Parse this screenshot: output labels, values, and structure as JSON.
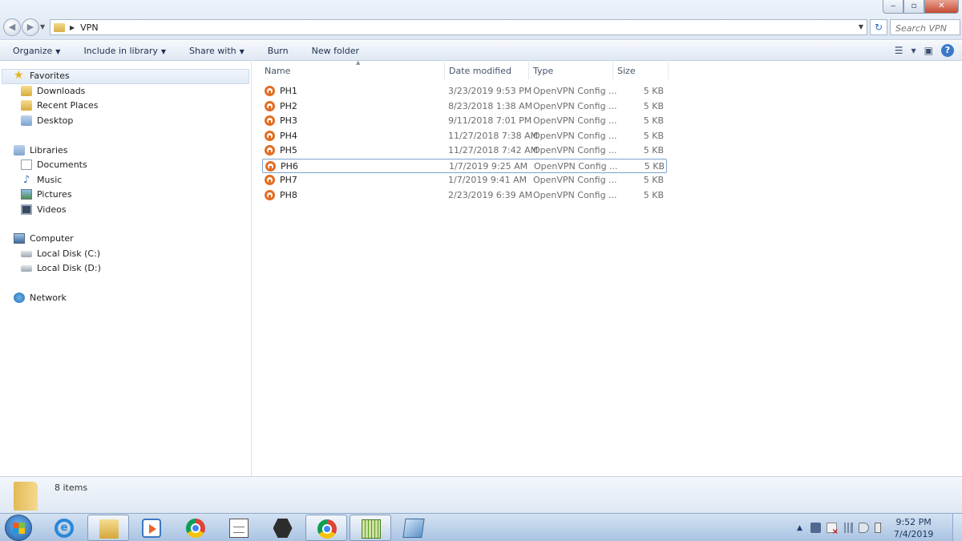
{
  "address_bar": {
    "path": [
      "VPN"
    ],
    "search_placeholder": "Search VPN"
  },
  "window_controls": {
    "minimize": "‒",
    "maximize": "▫",
    "close": "✕"
  },
  "toolbar": {
    "items": [
      {
        "label": "Organize",
        "dropdown": true
      },
      {
        "label": "Include in library",
        "dropdown": true
      },
      {
        "label": "Share with",
        "dropdown": true
      },
      {
        "label": "Burn",
        "dropdown": false
      },
      {
        "label": "New folder",
        "dropdown": false
      }
    ],
    "help_label": "?"
  },
  "nav_pane": {
    "favorites": {
      "label": "Favorites",
      "items": [
        "Downloads",
        "Recent Places",
        "Desktop"
      ]
    },
    "libraries": {
      "label": "Libraries",
      "items": [
        "Documents",
        "Music",
        "Pictures",
        "Videos"
      ]
    },
    "computer": {
      "label": "Computer",
      "items": [
        "Local Disk (C:)",
        "Local Disk (D:)"
      ]
    },
    "network": {
      "label": "Network"
    }
  },
  "file_list": {
    "columns": [
      "Name",
      "Date modified",
      "Type",
      "Size"
    ],
    "sorted_column": "Name",
    "rows": [
      {
        "name": "PH1",
        "date": "3/23/2019 9:53 PM",
        "type": "OpenVPN Config ...",
        "size": "5 KB"
      },
      {
        "name": "PH2",
        "date": "8/23/2018 1:38 AM",
        "type": "OpenVPN Config ...",
        "size": "5 KB"
      },
      {
        "name": "PH3",
        "date": "9/11/2018 7:01 PM",
        "type": "OpenVPN Config ...",
        "size": "5 KB"
      },
      {
        "name": "PH4",
        "date": "11/27/2018 7:38 AM",
        "type": "OpenVPN Config ...",
        "size": "5 KB"
      },
      {
        "name": "PH5",
        "date": "11/27/2018 7:42 AM",
        "type": "OpenVPN Config ...",
        "size": "5 KB"
      },
      {
        "name": "PH6",
        "date": "1/7/2019 9:25 AM",
        "type": "OpenVPN Config ...",
        "size": "5 KB",
        "selected": true
      },
      {
        "name": "PH7",
        "date": "1/7/2019 9:41 AM",
        "type": "OpenVPN Config ...",
        "size": "5 KB"
      },
      {
        "name": "PH8",
        "date": "2/23/2019 6:39 AM",
        "type": "OpenVPN Config ...",
        "size": "5 KB"
      }
    ]
  },
  "details_pane": {
    "item_count": "8 items"
  },
  "taskbar": {
    "apps": [
      {
        "name": "internet-explorer",
        "icon": "ie-icon",
        "active": false
      },
      {
        "name": "windows-explorer",
        "icon": "folder-icon",
        "active": true
      },
      {
        "name": "media-player",
        "icon": "media-player-icon",
        "active": false
      },
      {
        "name": "chrome",
        "icon": "chrome-icon",
        "active": false
      },
      {
        "name": "notepad",
        "icon": "notepad-icon",
        "active": false
      },
      {
        "name": "nox",
        "icon": "nox-icon",
        "active": false
      },
      {
        "name": "chrome-2",
        "icon": "chrome-icon",
        "active": true
      },
      {
        "name": "grid-app",
        "icon": "grid-app-icon",
        "active": true
      },
      {
        "name": "sheet-app",
        "icon": "sheet-app-icon",
        "active": false
      }
    ],
    "ie_glyph": "e",
    "tray_arrow": "▲",
    "clock": {
      "time": "9:52 PM",
      "date": "7/4/2019"
    }
  },
  "colors": {
    "accent": "#3c78c8",
    "openvpn_orange": "#e36d22",
    "selection_border": "#7da2ce"
  }
}
